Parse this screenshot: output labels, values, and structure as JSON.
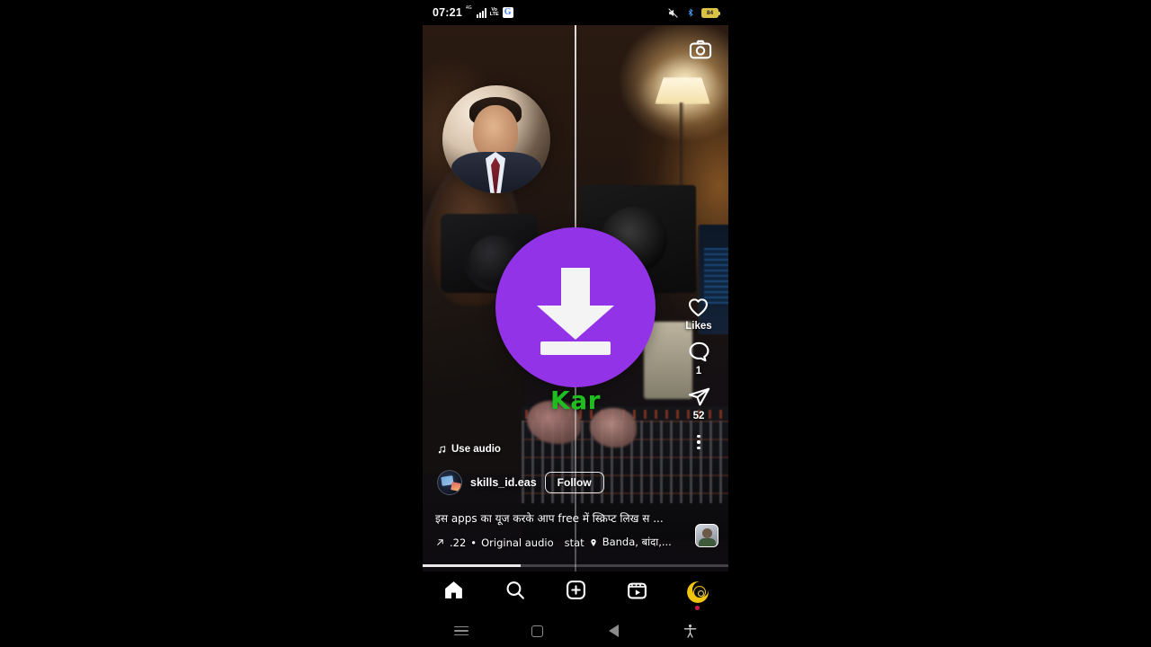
{
  "status_bar": {
    "time": "07:21",
    "network_type": "4G",
    "volte_line1": "Vo",
    "volte_line2": "LTE",
    "google_icon": "G",
    "icons": [
      "signal-bars-icon",
      "volte-icon",
      "google-icon",
      "mute-icon",
      "bluetooth-icon",
      "battery-icon"
    ],
    "battery_percent": "84"
  },
  "reel": {
    "camera_icon": "camera-icon",
    "overlay": {
      "download_icon": "download-arrow-icon",
      "accent_color": "#9333e8",
      "watermark_text": "Kar",
      "watermark_color": "#1fbd1f"
    },
    "actions": [
      {
        "name": "like",
        "icon": "heart-icon",
        "label": "Likes"
      },
      {
        "name": "comment",
        "icon": "comment-bubble-icon",
        "label": "1"
      },
      {
        "name": "share",
        "icon": "send-paperplane-icon",
        "label": "52"
      },
      {
        "name": "more",
        "icon": "more-vertical-icon",
        "label": ""
      }
    ],
    "use_audio": {
      "icon": "music-note-icon",
      "label": "Use audio"
    },
    "author": {
      "username": "skills_id.eas",
      "follow_label": "Follow",
      "avatar": "user-avatar"
    },
    "caption": "इस apps का यूज करके आप free में स्क्रिप्ट लिख स ...",
    "audio_meta": {
      "trend_icon": "trending-arrow-icon",
      "count": ".22",
      "separator": "•",
      "audio_name": "Original audio",
      "extra_text": "stat",
      "location_icon": "location-pin-icon",
      "location": "Banda, बांदा,...",
      "thumbnail": "audio-thumbnail"
    },
    "progress_percent": "32"
  },
  "bottom_nav": {
    "items": [
      {
        "name": "home",
        "icon": "home-icon",
        "active": true
      },
      {
        "name": "search",
        "icon": "search-icon",
        "active": false
      },
      {
        "name": "create",
        "icon": "plus-square-icon",
        "active": false
      },
      {
        "name": "reels",
        "icon": "reels-icon",
        "active": false
      },
      {
        "name": "profile",
        "icon": "profile-avatar-icon",
        "active": false
      }
    ]
  },
  "system_nav": {
    "items": [
      {
        "name": "recents",
        "icon": "menu-hamburger-icon"
      },
      {
        "name": "home",
        "icon": "square-home-icon"
      },
      {
        "name": "back",
        "icon": "back-triangle-icon"
      },
      {
        "name": "accessibility",
        "icon": "accessibility-icon"
      }
    ]
  }
}
